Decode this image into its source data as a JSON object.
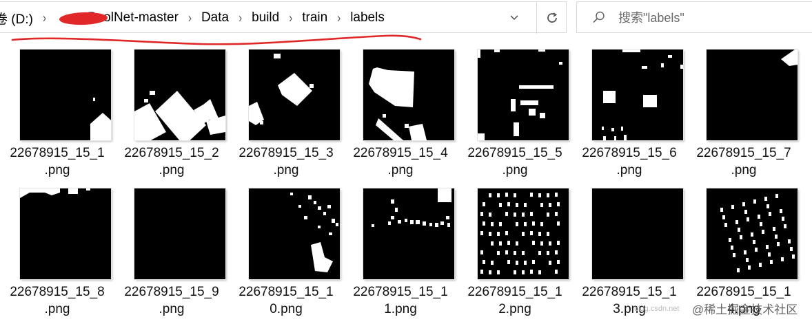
{
  "address_bar": {
    "path": [
      "卷 (D:)",
      "PoolNet-master",
      "Data",
      "build",
      "train",
      "labels"
    ],
    "separator": "›",
    "dropdown_icon": "chevron-down-icon",
    "refresh_icon": "refresh-icon"
  },
  "search": {
    "icon": "search-icon",
    "placeholder": "搜索\"labels\""
  },
  "files": [
    {
      "l1": "22678915_15_1",
      "l2": ".png"
    },
    {
      "l1": "22678915_15_2",
      "l2": ".png"
    },
    {
      "l1": "22678915_15_3",
      "l2": ".png"
    },
    {
      "l1": "22678915_15_4",
      "l2": ".png"
    },
    {
      "l1": "22678915_15_5",
      "l2": ".png"
    },
    {
      "l1": "22678915_15_6",
      "l2": ".png"
    },
    {
      "l1": "22678915_15_7",
      "l2": ".png"
    },
    {
      "l1": "22678915_15_8",
      "l2": ".png"
    },
    {
      "l1": "22678915_15_9",
      "l2": ".png"
    },
    {
      "l1": "22678915_15_1",
      "l2": "0.png"
    },
    {
      "l1": "22678915_15_1",
      "l2": "1.png"
    },
    {
      "l1": "22678915_15_1",
      "l2": "2.png"
    },
    {
      "l1": "22678915_15_1",
      "l2": "3.png"
    },
    {
      "l1": "22678915_15_1",
      "l2": "4.png"
    }
  ],
  "watermark": {
    "small": "blog.csdn.net",
    "main": "@稀土掘金技术社区"
  },
  "colors": {
    "annotation": "#e12828",
    "border": "#d9d9d9"
  }
}
